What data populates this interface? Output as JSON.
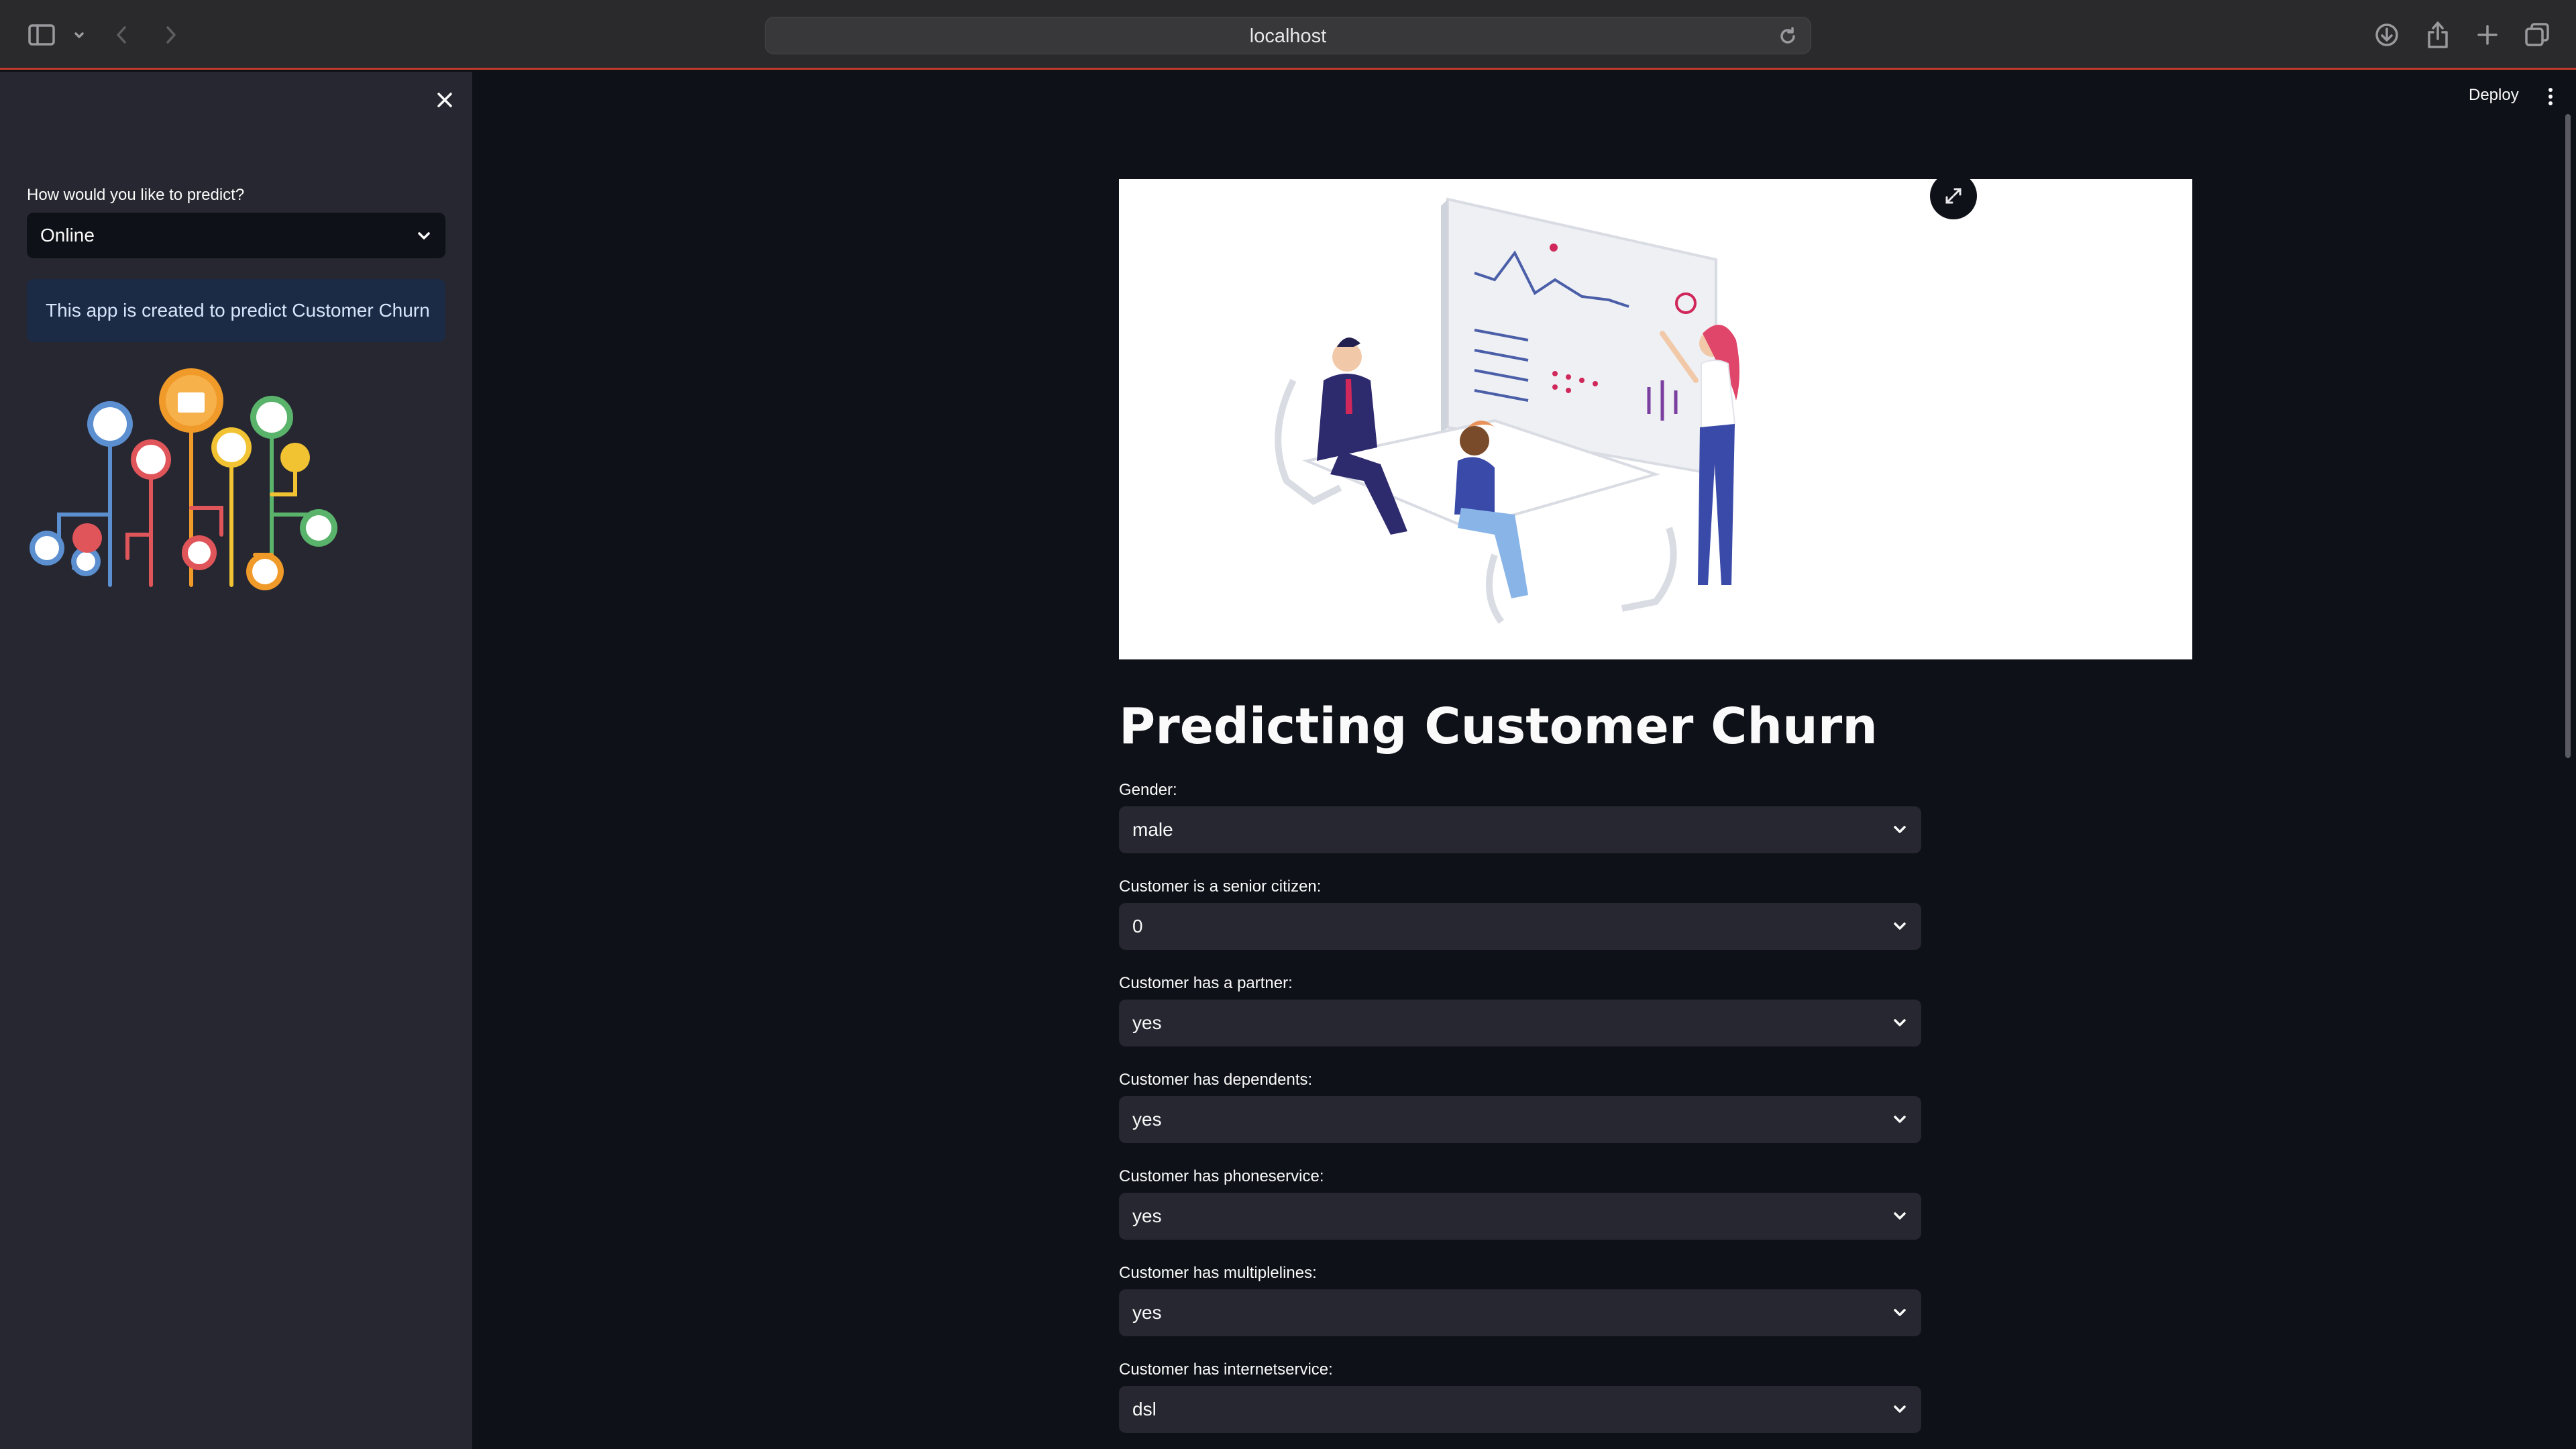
{
  "browser": {
    "url": "localhost"
  },
  "sidebar": {
    "predict_label": "How would you like to predict?",
    "predict_value": "Online",
    "info_text": "This app is created to predict Customer Churn"
  },
  "header": {
    "deploy_label": "Deploy"
  },
  "main": {
    "title": "Predicting Customer Churn",
    "fields": [
      {
        "label": "Gender:",
        "value": "male"
      },
      {
        "label": "Customer is a senior citizen:",
        "value": "0"
      },
      {
        "label": "Customer has a partner:",
        "value": "yes"
      },
      {
        "label": "Customer has dependents:",
        "value": "yes"
      },
      {
        "label": "Customer has phoneservice:",
        "value": "yes"
      },
      {
        "label": "Customer has multiplelines:",
        "value": "yes"
      },
      {
        "label": "Customer has internetservice:",
        "value": "dsl"
      }
    ]
  },
  "colors": {
    "background": "#0e1117",
    "sidebar": "#262730",
    "info_box": "#1c2b45",
    "browser_accent": "#c0392b"
  }
}
